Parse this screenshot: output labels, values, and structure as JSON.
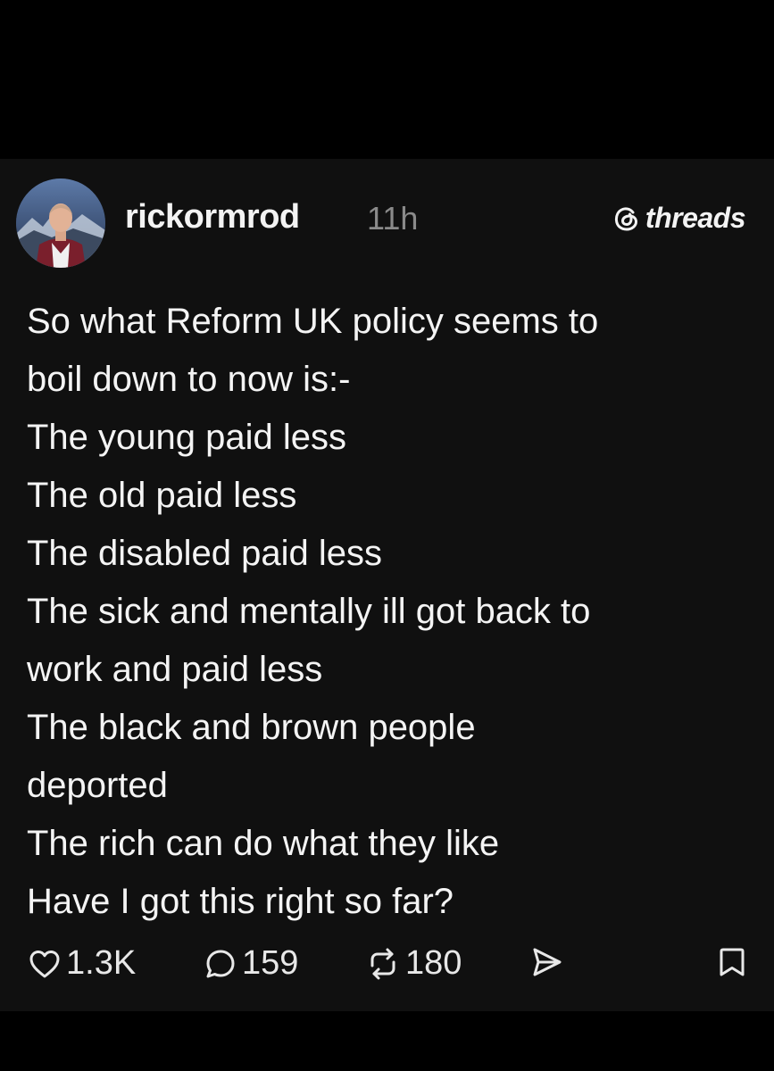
{
  "post": {
    "username": "rickormrod",
    "timestamp": "11h",
    "brand": {
      "label": "threads",
      "icon": "threads-logo-icon"
    },
    "avatar_icon": "user-avatar-photo",
    "lines": [
      "So what Reform UK policy seems to",
      "boil down to now is:-",
      "The young paid less",
      "The old paid less",
      "The disabled paid less",
      "The sick and mentally ill got back to",
      "work and paid less",
      "The black and brown people",
      "deported",
      "The rich can do what they like",
      "Have I got this right so far?"
    ]
  },
  "actions": {
    "likes": "1.3K",
    "replies": "159",
    "reposts": "180",
    "like_icon": "heart-icon",
    "reply_icon": "comment-icon",
    "repost_icon": "repost-icon",
    "share_icon": "share-icon",
    "save_icon": "bookmark-icon"
  },
  "colors": {
    "background": "#000000",
    "card": "#101010",
    "text": "#f4f4f4",
    "muted": "#8a8a8a"
  }
}
